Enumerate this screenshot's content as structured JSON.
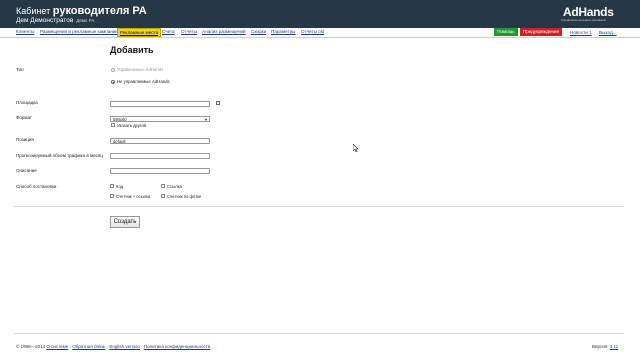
{
  "header": {
    "title_prefix": "Кабинет",
    "title_main": "руководителя РА",
    "user_name": "Дем Демонстратов",
    "user_org": "Демо РА",
    "logo": "AdHands",
    "logo_tagline": "Управление интернет-рекламой"
  },
  "nav": {
    "items": [
      "Клиенты",
      "Размещения и рекламные кампании",
      "Рекламные места",
      "Счета",
      "Отчеты",
      "Анализ размещений",
      "Скидки",
      "Параметры",
      "Отчеты old"
    ],
    "active_index": 2,
    "help": "Помощь",
    "warnings": "Предупреждения",
    "news": "Новости",
    "news_count": "1",
    "logout": "Выход..."
  },
  "form": {
    "title": "Добавить",
    "type_label": "Тип",
    "type_option_1": "Управляемые AdHands",
    "type_option_2": "Не управляемые AdHands",
    "site_label": "Площадка",
    "site_value": "",
    "format_label": "Формат",
    "format_value": "590x60",
    "other_label": "Указать другой",
    "position_label": "Позиция",
    "position_value": "default",
    "traffic_label": "Прогнозируемый объем трафика в месяц",
    "traffic_value": "",
    "desc_label": "Описание",
    "desc_value": "",
    "method_label": "Способ постановки",
    "methods": [
      "Код",
      "Ссылка",
      "Счетчик + ссылка",
      "Счетчик по фотке"
    ],
    "submit": "Создать"
  },
  "footer": {
    "copyright": "© 1998—2014",
    "about": "О системе",
    "feedback": "Обратная связь",
    "english": "English version",
    "privacy": "Политика конфиденциальности",
    "version_label": "Версия:",
    "version": "3.11"
  },
  "colors": {
    "header_bg": "#243845",
    "active_tab": "#f3d31a",
    "help_btn": "#1e9b28",
    "warn_btn": "#d11f23",
    "link": "#1a3d8f"
  }
}
